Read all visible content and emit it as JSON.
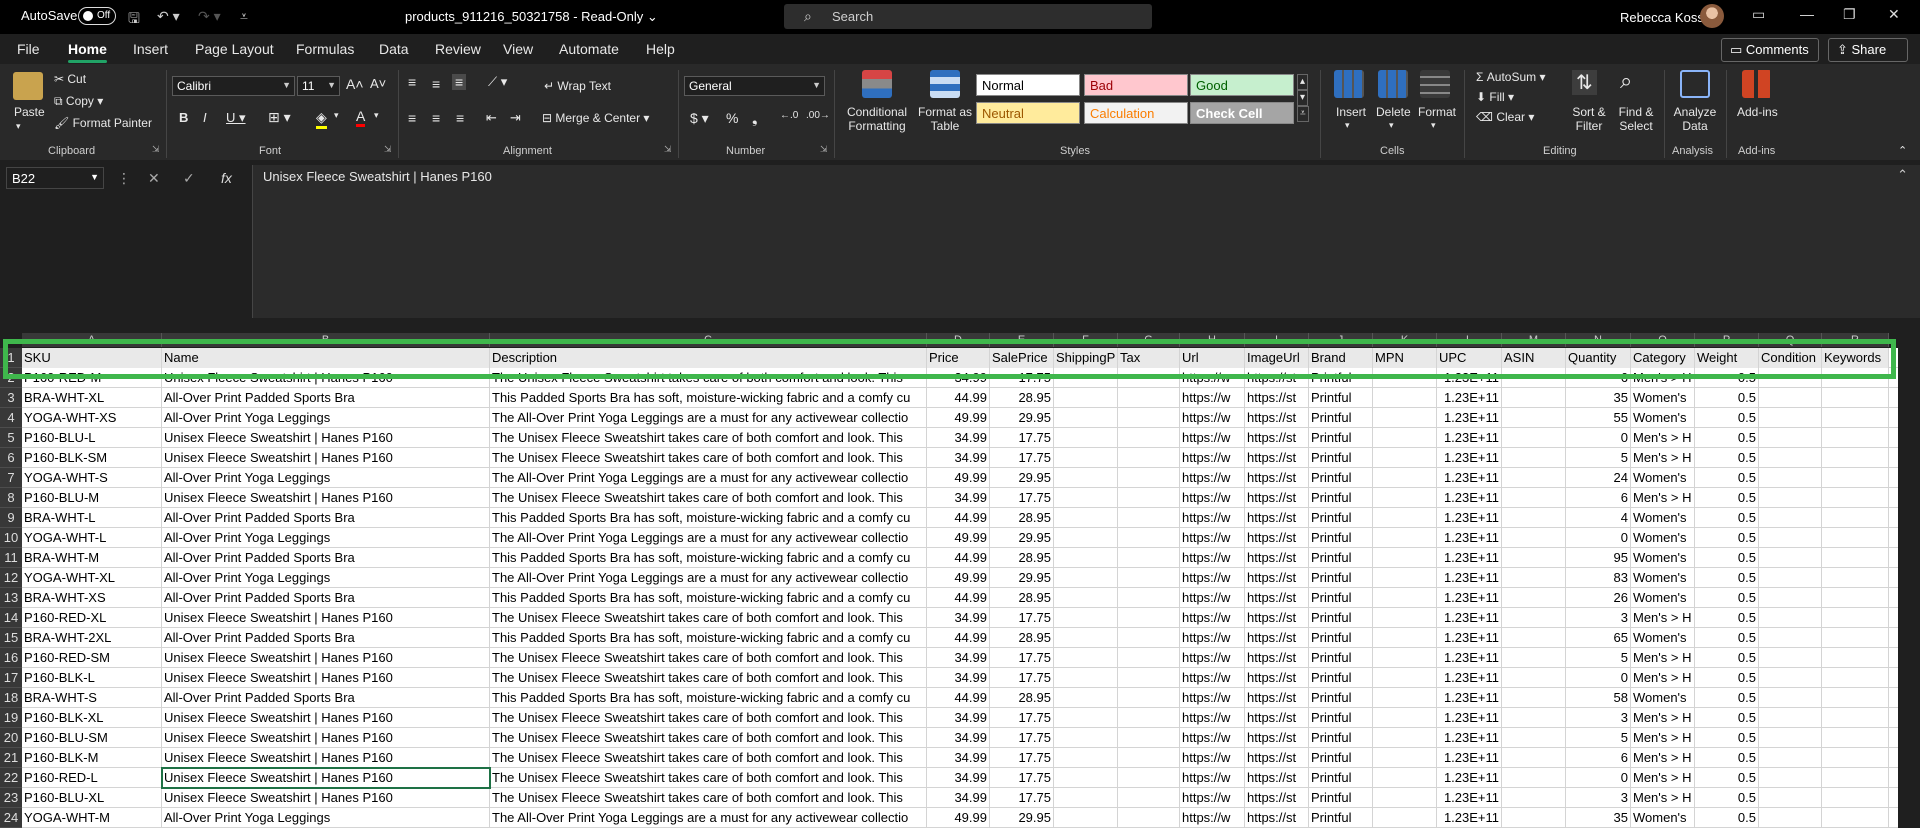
{
  "titlebar": {
    "autosave_label": "AutoSave",
    "autosave_state": "Off",
    "file_title": "products_911216_50321758  -  Read-Only ⌄",
    "search_placeholder": "Search",
    "user_name": "Rebecca Koss"
  },
  "menu": {
    "tabs": [
      "File",
      "Home",
      "Insert",
      "Page Layout",
      "Formulas",
      "Data",
      "Review",
      "View",
      "Automate",
      "Help"
    ],
    "comments": "Comments",
    "share": "Share"
  },
  "ribbon": {
    "clipboard": {
      "paste": "Paste",
      "cut": "Cut",
      "copy": "Copy",
      "format_painter": "Format Painter",
      "group": "Clipboard"
    },
    "font": {
      "name": "Calibri",
      "size": "11",
      "group": "Font"
    },
    "alignment": {
      "wrap": "Wrap Text",
      "merge": "Merge & Center",
      "group": "Alignment"
    },
    "number": {
      "format": "General",
      "group": "Number"
    },
    "styles": {
      "conditional": "Conditional Formatting",
      "format_table": "Format as Table",
      "group": "Styles",
      "items": [
        {
          "label": "Normal",
          "bg": "#ffffff",
          "fg": "#000000"
        },
        {
          "label": "Bad",
          "bg": "#ffc7ce",
          "fg": "#9c0006"
        },
        {
          "label": "Good",
          "bg": "#c6efce",
          "fg": "#006100"
        },
        {
          "label": "Neutral",
          "bg": "#ffeb9c",
          "fg": "#9c5700"
        },
        {
          "label": "Calculation",
          "bg": "#f2f2f2",
          "fg": "#fa7d00"
        },
        {
          "label": "Check Cell",
          "bg": "#a5a5a5",
          "fg": "#ffffff"
        }
      ]
    },
    "cells": {
      "insert": "Insert",
      "delete": "Delete",
      "format": "Format",
      "group": "Cells"
    },
    "editing": {
      "autosum": "AutoSum",
      "fill": "Fill",
      "clear": "Clear",
      "sort": "Sort & Filter",
      "find": "Find & Select",
      "group": "Editing"
    },
    "analysis": {
      "analyze": "Analyze Data",
      "group": "Analysis"
    },
    "addins": {
      "addins": "Add-ins",
      "group": "Add-ins"
    }
  },
  "formula_bar": {
    "name_box": "B22",
    "fx": "fx",
    "content": "Unisex Fleece Sweatshirt | Hanes P160"
  },
  "sheet": {
    "headers": [
      "SKU",
      "Name",
      "Description",
      "Price",
      "SalePrice",
      "ShippingP",
      "Tax",
      "Url",
      "ImageUrl",
      "Brand",
      "MPN",
      "UPC",
      "ASIN",
      "Quantity",
      "Category",
      "Weight",
      "Condition",
      "Keywords"
    ],
    "rows": [
      {
        "n": "2",
        "cells": [
          "P160-RED-M",
          "Unisex Fleece Sweatshirt | Hanes P160",
          "The Unisex Fleece Sweatshirt takes care of both comfort and look. This",
          "34.99",
          "17.75",
          "",
          "",
          "https://w",
          "https://st",
          "Printful",
          "",
          "1.23E+11",
          "",
          "6",
          "Men's > H",
          "0.5",
          "",
          ""
        ]
      },
      {
        "n": "3",
        "cells": [
          "BRA-WHT-XL",
          "All-Over Print Padded Sports Bra",
          "This Padded Sports Bra has soft, moisture-wicking fabric and a comfy cu",
          "44.99",
          "28.95",
          "",
          "",
          "https://w",
          "https://st",
          "Printful",
          "",
          "1.23E+11",
          "",
          "35",
          "Women's",
          "0.5",
          "",
          ""
        ]
      },
      {
        "n": "4",
        "cells": [
          "YOGA-WHT-XS",
          "All-Over Print Yoga Leggings",
          "The All-Over Print Yoga Leggings are a must for any activewear collectio",
          "49.99",
          "29.95",
          "",
          "",
          "https://w",
          "https://st",
          "Printful",
          "",
          "1.23E+11",
          "",
          "55",
          "Women's",
          "0.5",
          "",
          ""
        ]
      },
      {
        "n": "5",
        "cells": [
          "P160-BLU-L",
          "Unisex Fleece Sweatshirt | Hanes P160",
          "The Unisex Fleece Sweatshirt takes care of both comfort and look. This",
          "34.99",
          "17.75",
          "",
          "",
          "https://w",
          "https://st",
          "Printful",
          "",
          "1.23E+11",
          "",
          "0",
          "Men's > H",
          "0.5",
          "",
          ""
        ]
      },
      {
        "n": "6",
        "cells": [
          "P160-BLK-SM",
          "Unisex Fleece Sweatshirt | Hanes P160",
          "The Unisex Fleece Sweatshirt takes care of both comfort and look. This",
          "34.99",
          "17.75",
          "",
          "",
          "https://w",
          "https://st",
          "Printful",
          "",
          "1.23E+11",
          "",
          "5",
          "Men's > H",
          "0.5",
          "",
          ""
        ]
      },
      {
        "n": "7",
        "cells": [
          "YOGA-WHT-S",
          "All-Over Print Yoga Leggings",
          "The All-Over Print Yoga Leggings are a must for any activewear collectio",
          "49.99",
          "29.95",
          "",
          "",
          "https://w",
          "https://st",
          "Printful",
          "",
          "1.23E+11",
          "",
          "24",
          "Women's",
          "0.5",
          "",
          ""
        ]
      },
      {
        "n": "8",
        "cells": [
          "P160-BLU-M",
          "Unisex Fleece Sweatshirt | Hanes P160",
          "The Unisex Fleece Sweatshirt takes care of both comfort and look. This",
          "34.99",
          "17.75",
          "",
          "",
          "https://w",
          "https://st",
          "Printful",
          "",
          "1.23E+11",
          "",
          "6",
          "Men's > H",
          "0.5",
          "",
          ""
        ]
      },
      {
        "n": "9",
        "cells": [
          "BRA-WHT-L",
          "All-Over Print Padded Sports Bra",
          "This Padded Sports Bra has soft, moisture-wicking fabric and a comfy cu",
          "44.99",
          "28.95",
          "",
          "",
          "https://w",
          "https://st",
          "Printful",
          "",
          "1.23E+11",
          "",
          "4",
          "Women's",
          "0.5",
          "",
          ""
        ]
      },
      {
        "n": "10",
        "cells": [
          "YOGA-WHT-L",
          "All-Over Print Yoga Leggings",
          "The All-Over Print Yoga Leggings are a must for any activewear collectio",
          "49.99",
          "29.95",
          "",
          "",
          "https://w",
          "https://st",
          "Printful",
          "",
          "1.23E+11",
          "",
          "0",
          "Women's",
          "0.5",
          "",
          ""
        ]
      },
      {
        "n": "11",
        "cells": [
          "BRA-WHT-M",
          "All-Over Print Padded Sports Bra",
          "This Padded Sports Bra has soft, moisture-wicking fabric and a comfy cu",
          "44.99",
          "28.95",
          "",
          "",
          "https://w",
          "https://st",
          "Printful",
          "",
          "1.23E+11",
          "",
          "95",
          "Women's",
          "0.5",
          "",
          ""
        ]
      },
      {
        "n": "12",
        "cells": [
          "YOGA-WHT-XL",
          "All-Over Print Yoga Leggings",
          "The All-Over Print Yoga Leggings are a must for any activewear collectio",
          "49.99",
          "29.95",
          "",
          "",
          "https://w",
          "https://st",
          "Printful",
          "",
          "1.23E+11",
          "",
          "83",
          "Women's",
          "0.5",
          "",
          ""
        ]
      },
      {
        "n": "13",
        "cells": [
          "BRA-WHT-XS",
          "All-Over Print Padded Sports Bra",
          "This Padded Sports Bra has soft, moisture-wicking fabric and a comfy cu",
          "44.99",
          "28.95",
          "",
          "",
          "https://w",
          "https://st",
          "Printful",
          "",
          "1.23E+11",
          "",
          "26",
          "Women's",
          "0.5",
          "",
          ""
        ]
      },
      {
        "n": "14",
        "cells": [
          "P160-RED-XL",
          "Unisex Fleece Sweatshirt | Hanes P160",
          "The Unisex Fleece Sweatshirt takes care of both comfort and look. This",
          "34.99",
          "17.75",
          "",
          "",
          "https://w",
          "https://st",
          "Printful",
          "",
          "1.23E+11",
          "",
          "3",
          "Men's > H",
          "0.5",
          "",
          ""
        ]
      },
      {
        "n": "15",
        "cells": [
          "BRA-WHT-2XL",
          "All-Over Print Padded Sports Bra",
          "This Padded Sports Bra has soft, moisture-wicking fabric and a comfy cu",
          "44.99",
          "28.95",
          "",
          "",
          "https://w",
          "https://st",
          "Printful",
          "",
          "1.23E+11",
          "",
          "65",
          "Women's",
          "0.5",
          "",
          ""
        ]
      },
      {
        "n": "16",
        "cells": [
          "P160-RED-SM",
          "Unisex Fleece Sweatshirt | Hanes P160",
          "The Unisex Fleece Sweatshirt takes care of both comfort and look. This",
          "34.99",
          "17.75",
          "",
          "",
          "https://w",
          "https://st",
          "Printful",
          "",
          "1.23E+11",
          "",
          "5",
          "Men's > H",
          "0.5",
          "",
          ""
        ]
      },
      {
        "n": "17",
        "cells": [
          "P160-BLK-L",
          "Unisex Fleece Sweatshirt | Hanes P160",
          "The Unisex Fleece Sweatshirt takes care of both comfort and look. This",
          "34.99",
          "17.75",
          "",
          "",
          "https://w",
          "https://st",
          "Printful",
          "",
          "1.23E+11",
          "",
          "0",
          "Men's > H",
          "0.5",
          "",
          ""
        ]
      },
      {
        "n": "18",
        "cells": [
          "BRA-WHT-S",
          "All-Over Print Padded Sports Bra",
          "This Padded Sports Bra has soft, moisture-wicking fabric and a comfy cu",
          "44.99",
          "28.95",
          "",
          "",
          "https://w",
          "https://st",
          "Printful",
          "",
          "1.23E+11",
          "",
          "58",
          "Women's",
          "0.5",
          "",
          ""
        ]
      },
      {
        "n": "19",
        "cells": [
          "P160-BLK-XL",
          "Unisex Fleece Sweatshirt | Hanes P160",
          "The Unisex Fleece Sweatshirt takes care of both comfort and look. This",
          "34.99",
          "17.75",
          "",
          "",
          "https://w",
          "https://st",
          "Printful",
          "",
          "1.23E+11",
          "",
          "3",
          "Men's > H",
          "0.5",
          "",
          ""
        ]
      },
      {
        "n": "20",
        "cells": [
          "P160-BLU-SM",
          "Unisex Fleece Sweatshirt | Hanes P160",
          "The Unisex Fleece Sweatshirt takes care of both comfort and look. This",
          "34.99",
          "17.75",
          "",
          "",
          "https://w",
          "https://st",
          "Printful",
          "",
          "1.23E+11",
          "",
          "5",
          "Men's > H",
          "0.5",
          "",
          ""
        ]
      },
      {
        "n": "21",
        "cells": [
          "P160-BLK-M",
          "Unisex Fleece Sweatshirt | Hanes P160",
          "The Unisex Fleece Sweatshirt takes care of both comfort and look. This",
          "34.99",
          "17.75",
          "",
          "",
          "https://w",
          "https://st",
          "Printful",
          "",
          "1.23E+11",
          "",
          "6",
          "Men's > H",
          "0.5",
          "",
          ""
        ]
      },
      {
        "n": "22",
        "cells": [
          "P160-RED-L",
          "Unisex Fleece Sweatshirt | Hanes P160",
          "The Unisex Fleece Sweatshirt takes care of both comfort and look. This",
          "34.99",
          "17.75",
          "",
          "",
          "https://w",
          "https://st",
          "Printful",
          "",
          "1.23E+11",
          "",
          "0",
          "Men's > H",
          "0.5",
          "",
          ""
        ]
      },
      {
        "n": "23",
        "cells": [
          "P160-BLU-XL",
          "Unisex Fleece Sweatshirt | Hanes P160",
          "The Unisex Fleece Sweatshirt takes care of both comfort and look. This",
          "34.99",
          "17.75",
          "",
          "",
          "https://w",
          "https://st",
          "Printful",
          "",
          "1.23E+11",
          "",
          "3",
          "Men's > H",
          "0.5",
          "",
          ""
        ]
      },
      {
        "n": "24",
        "cells": [
          "YOGA-WHT-M",
          "All-Over Print Yoga Leggings",
          "The All-Over Print Yoga Leggings are a must for any activewear collectio",
          "49.99",
          "29.95",
          "",
          "",
          "https://w",
          "https://st",
          "Printful",
          "",
          "1.23E+11",
          "",
          "35",
          "Women's",
          "0.5",
          "",
          ""
        ]
      }
    ]
  }
}
